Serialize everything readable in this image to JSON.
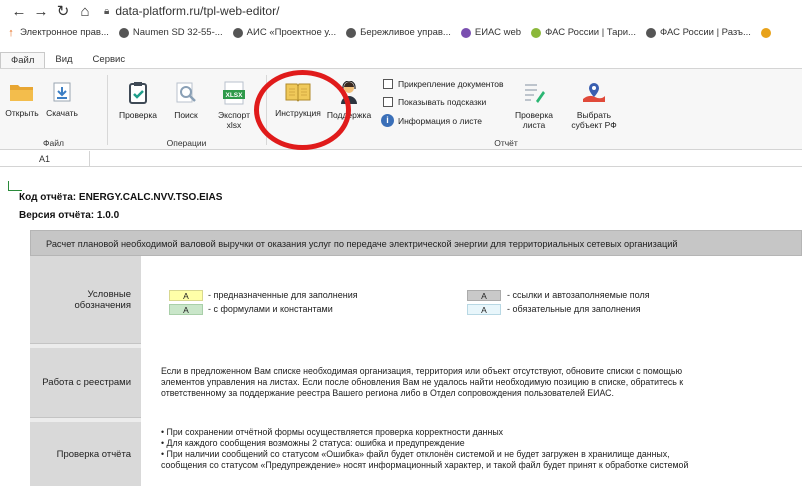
{
  "browser": {
    "url": "data-platform.ru/tpl-web-editor/"
  },
  "bookmarks": [
    {
      "label": "Электронное прав...",
      "color": "#e66a1a",
      "glyph": "↑"
    },
    {
      "label": "Naumen SD 32-55-...",
      "color": "#555555",
      "glyph": ""
    },
    {
      "label": "АИС «Проектное у...",
      "color": "#555555",
      "glyph": ""
    },
    {
      "label": "Бережливое управ...",
      "color": "#555555",
      "glyph": ""
    },
    {
      "label": "ЕИАС web",
      "color": "#7a4fb0",
      "glyph": ""
    },
    {
      "label": "ФАС России | Тари...",
      "color": "#8bb83a",
      "glyph": ""
    },
    {
      "label": "ФАС России | Разъ...",
      "color": "#555555",
      "glyph": ""
    }
  ],
  "menu": {
    "tabs": [
      "Файл",
      "Вид",
      "Сервис"
    ]
  },
  "ribbon": {
    "open": "Открыть",
    "download": "Скачать",
    "check": "Проверка",
    "search": "Поиск",
    "export_line1": "Экспорт",
    "export_line2": "xlsx",
    "export_icon_text": "XLSX",
    "instruction": "Инструкция",
    "support": "Поддержка",
    "attach_docs": "Прикрепление документов",
    "show_hints": "Показывать подсказки",
    "sheet_info": "Информация о листе",
    "check_sheet_line1": "Проверка",
    "check_sheet_line2": "листа",
    "select_subject_line1": "Выбрать",
    "select_subject_line2": "субъект РФ",
    "group_file": "Файл",
    "group_ops": "Операции",
    "group_report": "Отчёт"
  },
  "formula_bar": {
    "cell_ref": "A1"
  },
  "report": {
    "code": "Код отчёта: ENERGY.CALC.NVV.TSO.EIAS",
    "version": "Версия отчёта: 1.0.0",
    "banner": "Расчет плановой необходимой валовой выручки от оказания услуг по передаче электрической энергии для территориальных сетевых организаций"
  },
  "legend": {
    "label_line1": "Условные",
    "label_line2": "обозначения",
    "box_letter": "A",
    "items": [
      {
        "text": "- предназначенные для заполнения",
        "color": "#ffffa8"
      },
      {
        "text": "- с формулами и константами",
        "color": "#c9e6c9"
      },
      {
        "text": "- ссылки и автозаполняемые поля",
        "color": "#c9c9c9"
      },
      {
        "text": "- обязательные для заполнения",
        "color": "#e8f6fb"
      }
    ]
  },
  "registries": {
    "label": "Работа с реестрами",
    "line1": "Если в предложенном Вам списке необходимая организация, территория или объект отсутствуют, обновите списки с помощью",
    "line2": "элементов управления на листах. Если после обновления Вам не удалось найти необходимую позицию в списке, обратитесь к",
    "line3": "ответственному за поддержание реестра Вашего региона либо в Отдел сопровождения пользователей ЕИАС."
  },
  "report_check": {
    "label": "Проверка отчёта",
    "line1": "• При сохранении отчётной формы осуществляется проверка корректности данных",
    "line2": "• Для каждого сообщения возможны 2 статуса: ошибка и предупреждение",
    "line3": "• При наличии сообщений со статусом «Ошибка» файл будет отклонён системой и не будет загружен в хранилище данных,",
    "line4": "сообщения со статусом «Предупреждение» носят информационный характер, и такой файл будет принят к обработке системой"
  }
}
